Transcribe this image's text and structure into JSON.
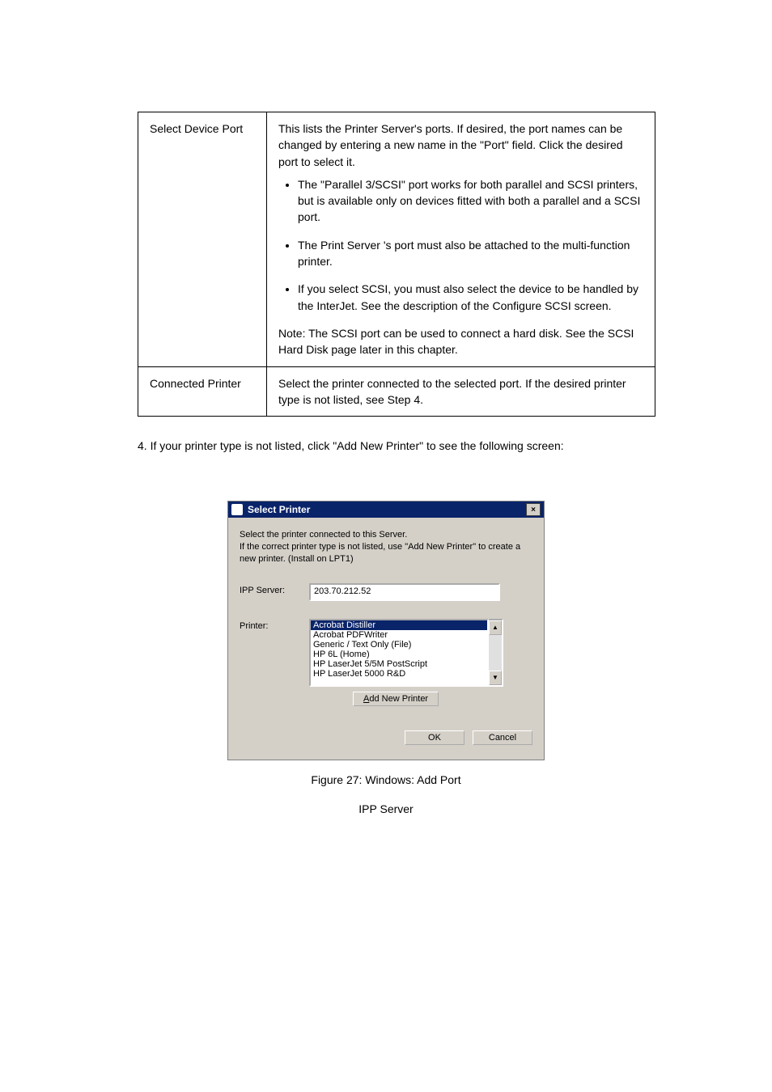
{
  "table": {
    "rows": [
      {
        "left": "Select Device Port",
        "intro": "This lists the Printer Server's ports. If desired, the port names can be changed by entering a new name in the \"Port\" field. Click the desired port to select it.",
        "bullets": [
          "The \"Parallel 3/SCSI\" port works for both parallel and SCSI printers, but is available only on devices fitted with both a parallel and a SCSI port.",
          "The Print Server 's port must also be attached to the multi-function printer.",
          "If you select SCSI, you must also select the device to be handled by the InterJet. See the description of the Configure SCSI screen."
        ],
        "note": "Note: The SCSI port can be used to connect a hard disk. See the SCSI Hard Disk page later in this chapter."
      },
      {
        "left": "Connected Printer",
        "right": "Select the printer connected to the selected port. If the desired printer type is not listed, see Step 4."
      }
    ]
  },
  "step4": {
    "text": "4. If your printer type is not listed, click \"Add New Printer\" to see the following screen:"
  },
  "dialog": {
    "title": "Select Printer",
    "desc": "Select the printer connected to this Server.\nIf the correct printer type is not listed, use \"Add New Printer\" to create a new printer. (Install on LPT1)",
    "ippLabel": "IPP Server:",
    "ippValue": "203.70.212.52",
    "printerLabel": "Printer:",
    "options": [
      "Acrobat Distiller",
      "Acrobat PDFWriter",
      "Generic / Text Only (File)",
      "HP 6L (Home)",
      "HP LaserJet 5/5M PostScript",
      "HP LaserJet 5000 R&D"
    ],
    "addBtnPrefix": "A",
    "addBtnRest": "dd New Printer",
    "ok": "OK",
    "cancel": "Cancel",
    "close": "×"
  },
  "figure": "Figure 27: Windows: Add Port"
}
